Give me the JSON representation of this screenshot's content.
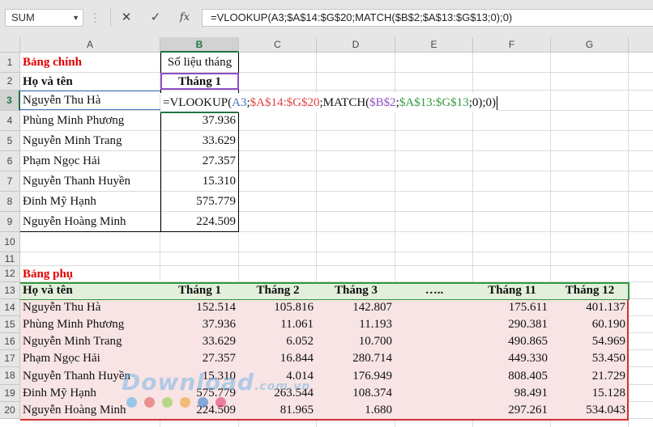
{
  "name_box": "SUM",
  "formula_bar": {
    "cancel_icon": "✕",
    "enter_icon": "✓",
    "fx_label": "fx",
    "formula": "=VLOOKUP(A3;$A$14:$G$20;MATCH($B$2;$A$13:$G$13;0);0)"
  },
  "columns": [
    "A",
    "B",
    "C",
    "D",
    "E",
    "F",
    "G"
  ],
  "rows": [
    "1",
    "2",
    "3",
    "4",
    "5",
    "6",
    "7",
    "8",
    "9",
    "10",
    "11",
    "12",
    "13",
    "14",
    "15",
    "16",
    "17",
    "18",
    "19",
    "20"
  ],
  "main_table": {
    "title": "Bảng chính",
    "b1": "Số liệu tháng",
    "header_name": "Họ và tên",
    "header_month": "Tháng 1",
    "names": [
      "Nguyễn Thu Hà",
      "Phùng Minh Phương",
      "Nguyễn Minh Trang",
      "Phạm Ngọc Hải",
      "Nguyễn Thanh Huyền",
      "Đinh Mỹ Hạnh",
      "Nguyễn Hoàng Minh"
    ],
    "values": [
      "",
      "37.936",
      "33.629",
      "27.357",
      "15.310",
      "575.779",
      "224.509"
    ]
  },
  "formula_parts": {
    "p1": "=VLOOKUP(",
    "p2": "A3",
    "p3": ";",
    "p4": "$A$14:$G$20",
    "p5": ";MATCH(",
    "p6": "$B$2",
    "p7": ";",
    "p8": "$A$13:$G$13",
    "p9": ";0);0)"
  },
  "sub_table": {
    "title": "Bảng phụ",
    "headers": [
      "Họ và tên",
      "Tháng 1",
      "Tháng 2",
      "Tháng 3",
      "…..",
      "Tháng 11",
      "Tháng 12"
    ],
    "rows": [
      [
        "Nguyễn Thu Hà",
        "152.514",
        "105.816",
        "142.807",
        "",
        "175.611",
        "401.137"
      ],
      [
        "Phùng Minh Phương",
        "37.936",
        "11.061",
        "11.193",
        "",
        "290.381",
        "60.190"
      ],
      [
        "Nguyễn Minh Trang",
        "33.629",
        "6.052",
        "10.700",
        "",
        "490.865",
        "54.969"
      ],
      [
        "Phạm Ngọc Hải",
        "27.357",
        "16.844",
        "280.714",
        "",
        "449.330",
        "53.450"
      ],
      [
        "Nguyễn Thanh Huyền",
        "15.310",
        "4.014",
        "176.949",
        "",
        "808.405",
        "21.729"
      ],
      [
        "Đinh Mỹ Hạnh",
        "575.779",
        "263.544",
        "108.374",
        "",
        "98.491",
        "15.128"
      ],
      [
        "Nguyễn Hoàng Minh",
        "224.509",
        "81.965",
        "1.680",
        "",
        "297.261",
        "534.043"
      ]
    ]
  },
  "watermark": {
    "main": "Download",
    "suffix": ".com.vn"
  },
  "colors": {
    "ref_blue": "#4472c4",
    "ref_red": "#e04040",
    "ref_purple": "#8e4ec6",
    "ref_green": "#2e9a3e",
    "excel_green": "#217346"
  }
}
